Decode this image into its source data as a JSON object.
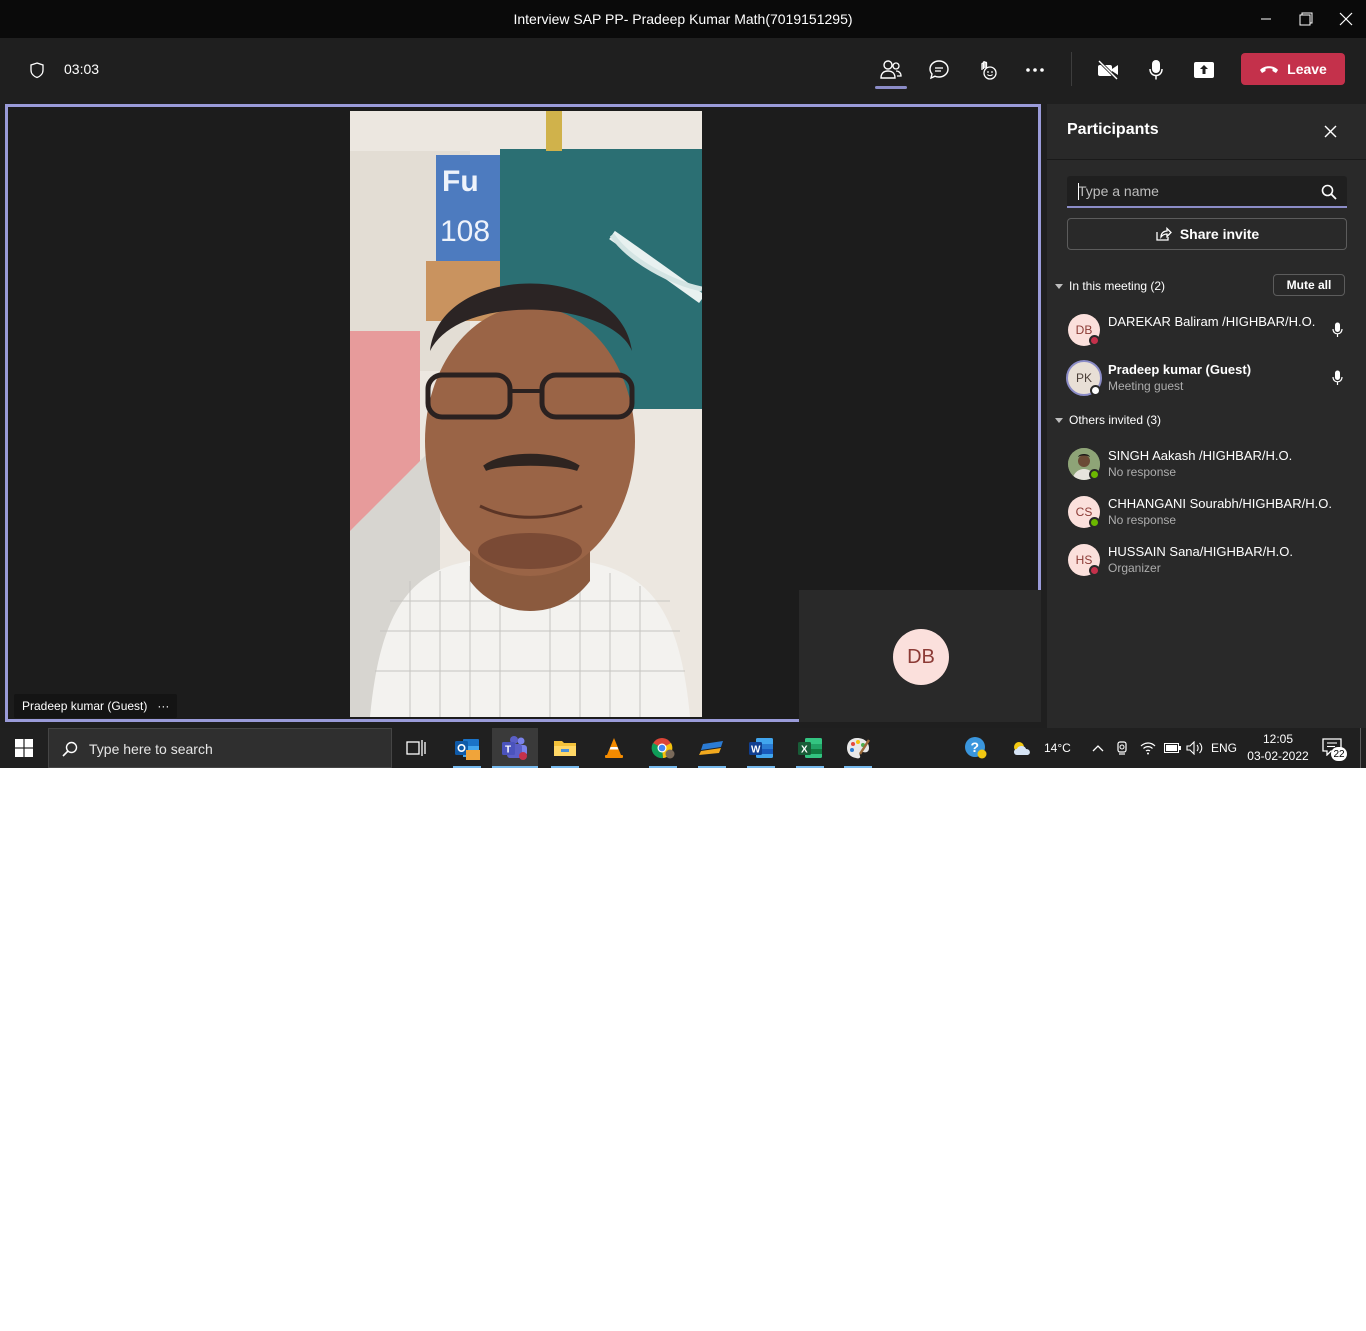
{
  "window": {
    "title": "Interview SAP PP- Pradeep Kumar Math(7019151295)",
    "controls": [
      "minimize",
      "restore",
      "close"
    ]
  },
  "toolbar": {
    "timer": "03:03",
    "leave_label": "Leave",
    "icons": [
      "shield-icon",
      "participants-icon",
      "chat-icon",
      "reactions-icon",
      "more-icon",
      "camera-off-icon",
      "mic-icon",
      "share-screen-icon",
      "hangup-icon"
    ],
    "accent_color": "#8b8cc7",
    "leave_color": "#c4314b"
  },
  "stage": {
    "speaker_name": "Pradeep kumar (Guest)",
    "more_label": "···",
    "self_initials": "DB",
    "video_overlay_text": {
      "line1": "Fu",
      "line2": "108"
    }
  },
  "panel": {
    "title": "Participants",
    "search_placeholder": "Type a name",
    "share_invite": "Share invite",
    "in_meeting_header": "In this meeting (2)",
    "mute_all": "Mute all",
    "others_header": "Others invited (3)",
    "in_meeting": [
      {
        "initials": "DB",
        "name": "DAREKAR Baliram /HIGHBAR/H.O.",
        "sub": "",
        "presence": "busy",
        "mic": true
      },
      {
        "initials": "PK",
        "name": "Pradeep kumar (Guest)",
        "sub": "Meeting guest",
        "presence": "offline",
        "mic": true
      }
    ],
    "invited": [
      {
        "initials": "",
        "name": "SINGH Aakash /HIGHBAR/H.O.",
        "sub": "No response",
        "presence": "available",
        "photo": true
      },
      {
        "initials": "CS",
        "name": "CHHANGANI Sourabh/HIGHBAR/H.O.",
        "sub": "No response",
        "presence": "available"
      },
      {
        "initials": "HS",
        "name": "HUSSAIN Sana/HIGHBAR/H.O.",
        "sub": "Organizer",
        "presence": "busy"
      }
    ],
    "presence_colors": {
      "busy": "#c4314b",
      "available": "#6bb700",
      "offline": "#ffffff"
    }
  },
  "taskbar": {
    "search_placeholder": "Type here to search",
    "apps": [
      "task-view-icon",
      "outlook-icon",
      "teams-icon",
      "file-explorer-icon",
      "vlc-icon",
      "chrome-icon",
      "app-icon",
      "word-icon",
      "excel-icon",
      "paint-icon"
    ],
    "temperature": "14°C",
    "language": "ENG",
    "time": "12:05",
    "date": "03-02-2022",
    "notification_count": "22"
  }
}
